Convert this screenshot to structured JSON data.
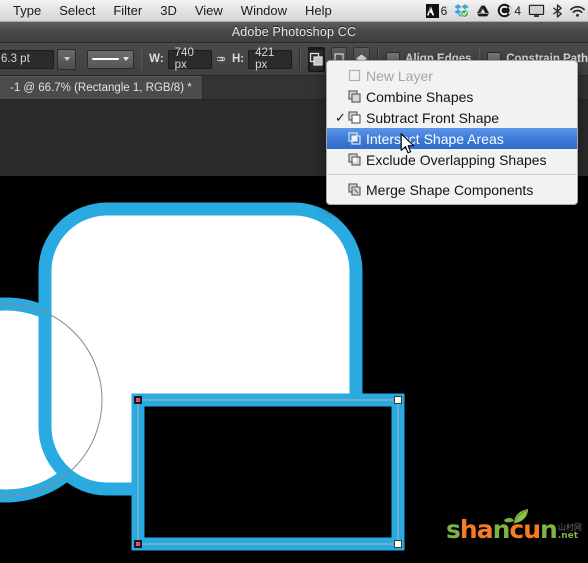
{
  "os_menu": {
    "items": [
      {
        "label": "Type"
      },
      {
        "label": "Select"
      },
      {
        "label": "Filter"
      },
      {
        "label": "3D"
      },
      {
        "label": "View"
      },
      {
        "label": "Window"
      },
      {
        "label": "Help"
      }
    ],
    "status_items": [
      {
        "icon": "adobe-logo-icon",
        "badge": "6"
      },
      {
        "icon": "dropbox-icon",
        "badge": ""
      },
      {
        "icon": "google-drive-icon",
        "badge": ""
      },
      {
        "icon": "creative-cloud-icon",
        "badge": "4"
      },
      {
        "icon": "display-icon",
        "badge": ""
      },
      {
        "icon": "bluetooth-icon",
        "badge": ""
      },
      {
        "icon": "wifi-icon",
        "badge": ""
      }
    ]
  },
  "window": {
    "title": "Adobe Photoshop CC"
  },
  "options_bar": {
    "stroke_weight": "6.3 pt",
    "stroke_style_icon": "stroke-style-icon",
    "width_label": "W:",
    "width_value": "740 px",
    "link_icon": "link-dimensions-icon",
    "height_label": "H:",
    "height_value": "421 px",
    "path_operations_icon": "path-operations-icon",
    "path_alignment_icon": "path-alignment-icon",
    "path_arrangement_icon": "path-arrangement-icon",
    "align_edges_label": "Align Edges",
    "constrain_path_label": "Constrain Path"
  },
  "document": {
    "tab_title": "-1 @ 66.7% (Rectangle 1, RGB/8) *"
  },
  "dropdown_menu": {
    "items": [
      {
        "label": "New Layer",
        "icon": "new-layer-icon",
        "checked": false,
        "disabled": true,
        "selected": false
      },
      {
        "label": "Combine Shapes",
        "icon": "combine-shapes-icon",
        "checked": false,
        "disabled": false,
        "selected": false
      },
      {
        "label": "Subtract Front Shape",
        "icon": "subtract-front-shape-icon",
        "checked": true,
        "disabled": false,
        "selected": false
      },
      {
        "label": "Intersect Shape Areas",
        "icon": "intersect-shape-areas-icon",
        "checked": false,
        "disabled": false,
        "selected": true
      },
      {
        "label": "Exclude Overlapping Shapes",
        "icon": "exclude-overlapping-shapes-icon",
        "checked": false,
        "disabled": false,
        "selected": false
      }
    ],
    "footer_item": {
      "label": "Merge Shape Components",
      "icon": "merge-shape-components-icon"
    },
    "checkmark": "✓",
    "highlight_color": "#3f7bd8"
  },
  "canvas": {
    "shape_stroke_color": "#29ABE2",
    "shape_fill_color": "#FFFFFF",
    "background_color": "#000000",
    "path_outline_color": "#8a8a8a",
    "selection_handle_color": "#FFFFFF"
  },
  "watermark": {
    "part1": "s",
    "part2": "h",
    "part3": "a",
    "part4": "n",
    "part5": "c",
    "part6": "u",
    "part7": "n",
    "cn_text": "山村网",
    "net_text": ".net"
  }
}
